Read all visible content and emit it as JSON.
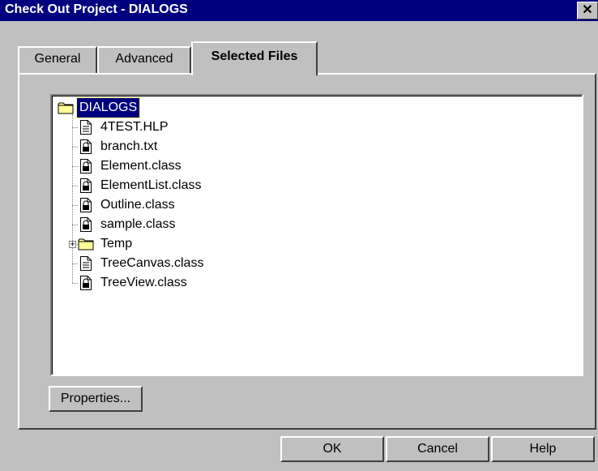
{
  "window": {
    "title": "Check Out Project - DIALOGS",
    "close_glyph": "✕"
  },
  "tabs": [
    {
      "label": "General",
      "active": false
    },
    {
      "label": "Advanced",
      "active": false
    },
    {
      "label": "Selected Files",
      "active": true
    }
  ],
  "tree": {
    "root": {
      "label": "DIALOGS",
      "icon": "folder-icon",
      "selected": true
    },
    "items": [
      {
        "label": "4TEST.HLP",
        "icon": "file-icon",
        "locked": false,
        "expandable": false
      },
      {
        "label": "branch.txt",
        "icon": "locked-file-icon",
        "locked": true,
        "expandable": false
      },
      {
        "label": "Element.class",
        "icon": "locked-file-icon",
        "locked": true,
        "expandable": false
      },
      {
        "label": "ElementList.class",
        "icon": "locked-file-icon",
        "locked": true,
        "expandable": false
      },
      {
        "label": "Outline.class",
        "icon": "locked-file-icon",
        "locked": true,
        "expandable": false
      },
      {
        "label": "sample.class",
        "icon": "locked-file-icon",
        "locked": true,
        "expandable": false
      },
      {
        "label": "Temp",
        "icon": "folder-icon",
        "locked": false,
        "expandable": true,
        "expand_glyph": "+"
      },
      {
        "label": "TreeCanvas.class",
        "icon": "file-icon",
        "locked": false,
        "expandable": false
      },
      {
        "label": "TreeView.class",
        "icon": "locked-file-icon",
        "locked": true,
        "expandable": false
      }
    ]
  },
  "buttons": {
    "properties": "Properties...",
    "ok": "OK",
    "cancel": "Cancel",
    "help": "Help"
  },
  "colors": {
    "title_bar": "#00007f",
    "selection": "#00007f",
    "face": "#c0c0c0",
    "folder": "#ffff99"
  }
}
